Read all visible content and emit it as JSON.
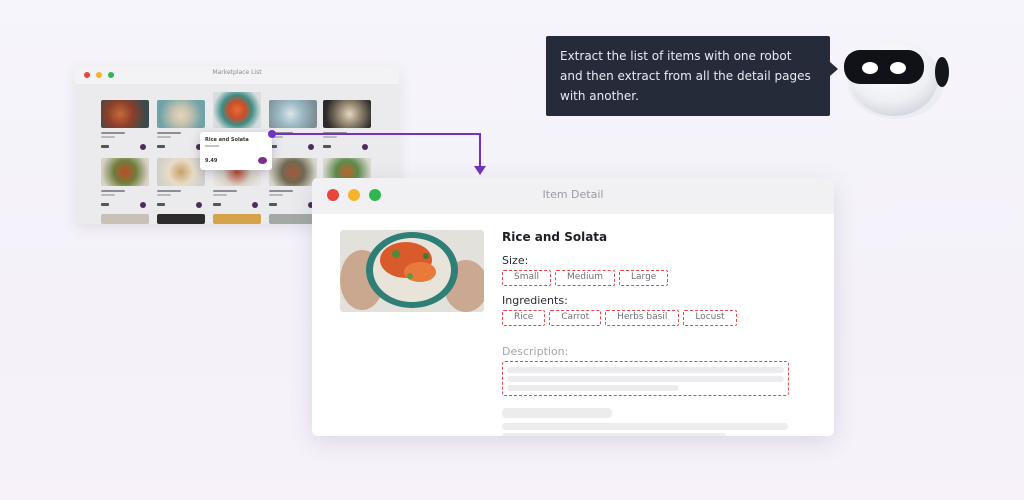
{
  "marketplace": {
    "title": "Marketplace List",
    "popup": {
      "title": "Rice and Solata",
      "price": "9.49"
    }
  },
  "bubble": {
    "text": "Extract the list of items with one robot and then extract from all the detail pages with another."
  },
  "detail": {
    "title": "Item Detail",
    "item_name": "Rice and Solata",
    "size_label": "Size:",
    "sizes": [
      "Small",
      "Medium",
      "Large"
    ],
    "ingredients_label": "Ingredients:",
    "ingredients": [
      "Rice",
      "Carrot",
      "Herbs basil",
      "Locust"
    ],
    "description_label": "Description:"
  },
  "colors": {
    "window_close": "#e8453c",
    "window_minimize": "#f4b42b",
    "window_maximize": "#2fb84f",
    "connector": "#6e33c2",
    "extract_outline": "#e5464e",
    "bubble_bg": "#262b3a"
  },
  "icons": [
    "robot-icon",
    "eye-icon",
    "arrow-down-icon"
  ]
}
